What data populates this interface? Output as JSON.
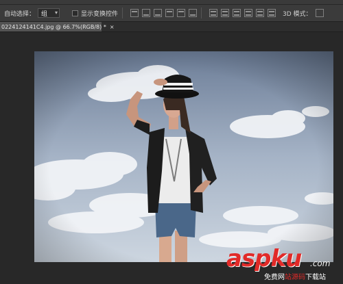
{
  "options": {
    "auto_select_label": "自动选择：",
    "auto_select_value": "组",
    "transform_label": "显示变换控件",
    "mode_label": "3D 模式："
  },
  "tab": {
    "title": "0224124141C4.jpg @ 66.7%(RGB/8) *",
    "close": "×"
  },
  "watermark": {
    "logo": "aspku",
    "com": ".com",
    "sub_prefix": "免费网",
    "sub_highlight": "站源码",
    "sub_suffix": "下载站"
  },
  "icons": [
    "align-top-icon",
    "align-vcenter-icon",
    "align-bottom-icon",
    "align-left-icon",
    "align-hcenter-icon",
    "align-right-icon",
    "distribute-top-icon",
    "distribute-vcenter-icon",
    "distribute-bottom-icon",
    "distribute-left-icon",
    "distribute-hcenter-icon",
    "distribute-right-icon",
    "3d-rotate-icon"
  ]
}
